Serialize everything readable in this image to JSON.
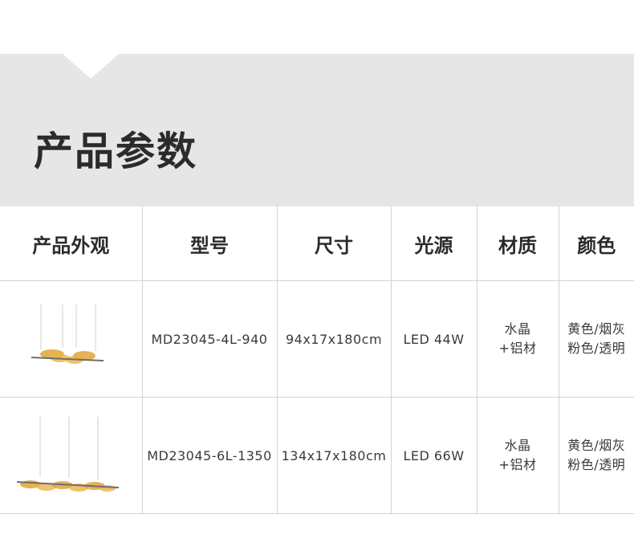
{
  "header": {
    "title": "产品参数"
  },
  "table": {
    "headers": [
      "产品外观",
      "型号",
      "尺寸",
      "光源",
      "材质",
      "颜色"
    ],
    "rows": [
      {
        "image": "pendant-lamp-4-light",
        "model": "MD23045-4L-940",
        "size": "94x17x180cm",
        "light": "LED 44W",
        "material": [
          "水晶",
          "+铝材"
        ],
        "color": [
          "黄色/烟灰",
          "粉色/透明"
        ]
      },
      {
        "image": "pendant-lamp-6-light",
        "model": "MD23045-6L-1350",
        "size": "134x17x180cm",
        "light": "LED 66W",
        "material": [
          "水晶",
          "+铝材"
        ],
        "color": [
          "黄色/烟灰",
          "粉色/透明"
        ]
      }
    ]
  },
  "colors": {
    "banner": "#e6e6e6",
    "grid": "#d2d2d2",
    "lamp_gold": "#e0a436",
    "lamp_bar": "#6e6e6e"
  }
}
